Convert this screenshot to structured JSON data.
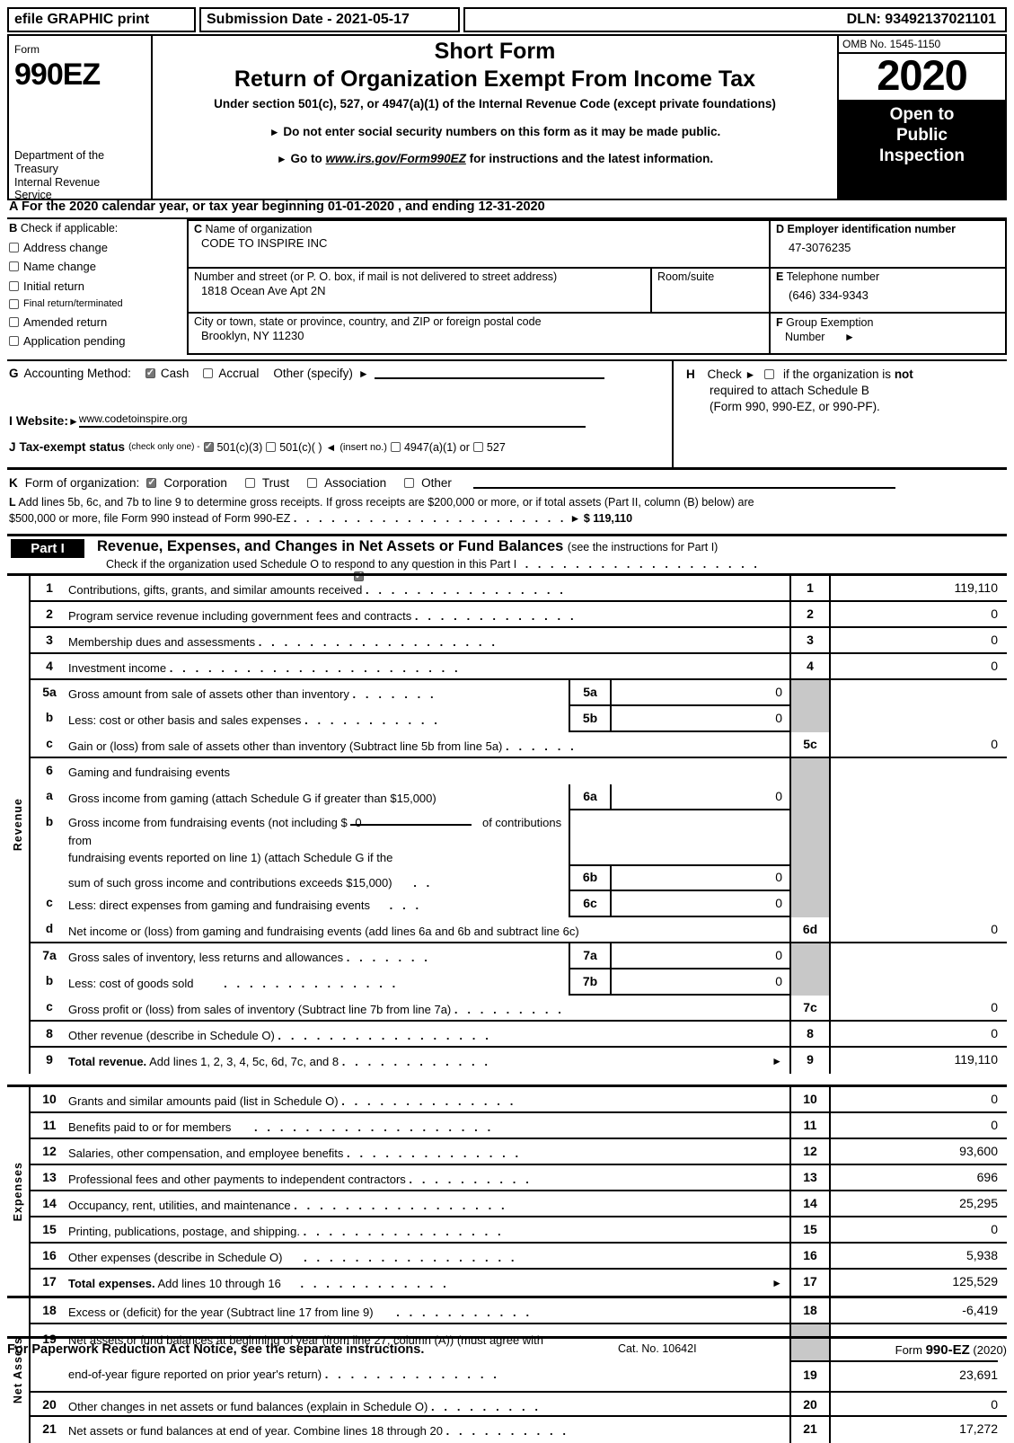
{
  "efile_bar": {
    "print_label": "efile GRAPHIC print",
    "submission_date": "Submission Date - 2021-05-17",
    "dln": "DLN: 93492137021101"
  },
  "header": {
    "form_label": "Form",
    "form_number": "990EZ",
    "department": "Department of the Treasury Internal Revenue Service",
    "title_line1": "Short Form",
    "title_line2": "Return of Organization Exempt From Income Tax",
    "subtitle": "Under section 501(c), 527, or 4947(a)(1) of the Internal Revenue Code (except private foundations)",
    "bullet1": "Do not enter social security numbers on this form as it may be made public.",
    "bullet2_prefix": "Go to",
    "bullet2_link": "www.irs.gov/Form990EZ",
    "bullet2_suffix": "for instructions and the latest information.",
    "omb": "OMB No. 1545-1150",
    "tax_year": "2020",
    "open_to_public": "Open to Public Inspection"
  },
  "line_a": {
    "letter": "A",
    "text": "For the 2020 calendar year, or tax year beginning 01-01-2020 , and ending 12-31-2020"
  },
  "section_b": {
    "letter": "B",
    "heading": "Check if applicable:",
    "items": [
      {
        "label": "Address change",
        "checked": false
      },
      {
        "label": "Name change",
        "checked": false
      },
      {
        "label": "Initial return",
        "checked": false
      },
      {
        "label": "Final return/terminated",
        "checked": false
      },
      {
        "label": "Amended return",
        "checked": false
      },
      {
        "label": "Application pending",
        "checked": false
      }
    ]
  },
  "section_c": {
    "letter": "C",
    "name_label": "Name of organization",
    "name_value": "CODE TO INSPIRE INC",
    "street_label": "Number and street (or P. O. box, if mail is not delivered to street address)",
    "street_value": "1818 Ocean Ave Apt 2N",
    "room_label": "Room/suite",
    "room_value": "",
    "city_label": "City or town, state or province, country, and ZIP or foreign postal code",
    "city_value": "Brooklyn, NY   11230"
  },
  "section_d": {
    "letter": "D",
    "ein_label": "Employer identification number",
    "ein_value": "47-3076235",
    "tel_letter": "E",
    "tel_label": "Telephone number",
    "tel_value": "(646) 334-9343",
    "group_letter": "F",
    "group_label_1": "Group Exemption",
    "group_label_2": "Number"
  },
  "section_g": {
    "letter": "G",
    "label": "Accounting Method:",
    "cash": "Cash",
    "cash_checked": true,
    "accrual": "Accrual",
    "accrual_checked": false,
    "other": "Other (specify)"
  },
  "section_h": {
    "letter": "H",
    "line1_pre": "Check",
    "line1_post": "if the organization is",
    "line1_bold": "not",
    "line2": "required to attach Schedule B",
    "line3": "(Form 990, 990-EZ, or 990-PF).",
    "checked": false
  },
  "section_i": {
    "letter": "I",
    "label": "Website:",
    "value": "www.codetoinspire.org"
  },
  "section_j": {
    "letter": "J",
    "label": "Tax-exempt status",
    "note": "(check only one) -",
    "opt1": "501(c)(3)",
    "opt1_checked": true,
    "opt2": "501(c)(   )",
    "opt2_checked": false,
    "insert": "(insert no.)",
    "opt3": "4947(a)(1) or",
    "opt3_checked": false,
    "opt4": "527",
    "opt4_checked": false
  },
  "section_k": {
    "letter": "K",
    "label": "Form of organization:",
    "options": [
      {
        "label": "Corporation",
        "checked": true
      },
      {
        "label": "Trust",
        "checked": false
      },
      {
        "label": "Association",
        "checked": false
      },
      {
        "label": "Other",
        "checked": false
      }
    ]
  },
  "section_l": {
    "letter": "L",
    "line1": "Add lines 5b, 6c, and 7b to line 9 to determine gross receipts. If gross receipts are $200,000 or more, or if total assets (Part II, column (B) below) are",
    "line2": "$500,000 or more, file Form 990 instead of Form 990-EZ",
    "dots": ". . . . . . . . . . . . . . . . . . . . . .",
    "amount": "$ 119,110"
  },
  "part1": {
    "badge": "Part I",
    "title": "Revenue, Expenses, and Changes in Net Assets or Fund Balances",
    "title_note": "(see the instructions for Part I)",
    "check_text": "Check if the organization used Schedule O to respond to any question in this Part I",
    "check_dots": ". . . . . . . . . . . . . . . . . . .",
    "checked": true
  },
  "revenue": {
    "vlabel": "Revenue",
    "rows": [
      {
        "num": "1",
        "desc": "Contributions, gifts, grants, and similar amounts received",
        "dots": ". . . . . . . . . . . . . . . .",
        "key": "1",
        "value": "119,110"
      },
      {
        "num": "2",
        "desc": "Program service revenue including government fees and contracts",
        "dots": ". . . . . . . . . . . . .",
        "key": "2",
        "value": "0"
      },
      {
        "num": "3",
        "desc": "Membership dues and assessments",
        "dots": ". . . . . . . . . . . . . . . . . . .",
        "key": "3",
        "value": "0"
      },
      {
        "num": "4",
        "desc": "Investment income",
        "dots": ". . . . . . . . . . . . . . . . . . . . . . .",
        "key": "4",
        "value": "0"
      },
      {
        "num": "5a",
        "desc": "Gross amount from sale of assets other than inventory",
        "dots": ". . . . . . .",
        "inner_label": "5a",
        "inner_value": "0",
        "key": "",
        "key_shade": true,
        "value": ""
      },
      {
        "num": "b",
        "desc": "Less: cost or other basis and sales expenses",
        "dots": ". . . . . . . . . . .",
        "inner_label": "5b",
        "inner_value": "0",
        "key": "",
        "key_shade": true,
        "value": ""
      },
      {
        "num": "c",
        "desc": "Gain or (loss) from sale of assets other than inventory (Subtract line 5b from line 5a)",
        "dots": ". . . . . .",
        "key": "5c",
        "value": "0"
      },
      {
        "num": "6",
        "desc": "Gaming and fundraising events",
        "dots": "",
        "key": "",
        "key_shade": true,
        "value": ""
      },
      {
        "num": "a",
        "desc": "Gross income from gaming (attach Schedule G if greater than $15,000)",
        "dots": "",
        "inner_label": "6a",
        "inner_value": "0",
        "key": "",
        "key_shade": true,
        "value": ""
      },
      {
        "num": "b",
        "desc_l1": "Gross income from fundraising events (not including $",
        "inline_value": "0",
        "desc_l1b": "of contributions from",
        "desc_l2": "fundraising events reported on line 1) (attach Schedule G if the",
        "desc_l3": "sum of such gross income and contributions exceeds $15,000)",
        "dots": ". .",
        "inner_label": "6b",
        "inner_value": "0",
        "key": "",
        "key_shade": true,
        "value": ""
      },
      {
        "num": "c",
        "desc": "Less: direct expenses from gaming and fundraising events",
        "dots": ". . .",
        "inner_label": "6c",
        "inner_value": "0",
        "key": "",
        "key_shade": true,
        "value": ""
      },
      {
        "num": "d",
        "desc": "Net income or (loss) from gaming and fundraising events (add lines 6a and 6b and subtract line 6c)",
        "dots": "",
        "key": "6d",
        "value": "0"
      },
      {
        "num": "7a",
        "desc": "Gross sales of inventory, less returns and allowances",
        "dots": ". . . . . . .",
        "inner_label": "7a",
        "inner_value": "0",
        "key": "",
        "key_shade": true,
        "value": ""
      },
      {
        "num": "b",
        "desc": "Less: cost of goods sold",
        "dots": ". . . . . . . . . . . . . .",
        "inner_label": "7b",
        "inner_value": "0",
        "key": "",
        "key_shade": true,
        "value": ""
      },
      {
        "num": "c",
        "desc": "Gross profit or (loss) from sales of inventory (Subtract line 7b from line 7a)",
        "dots": ". . . . . . . . .",
        "key": "7c",
        "value": "0"
      },
      {
        "num": "8",
        "desc": "Other revenue (describe in Schedule O)",
        "dots": ". . . . . . . . . . . . . . . . .",
        "key": "8",
        "value": "0"
      },
      {
        "num": "9",
        "desc_bold": "Total revenue.",
        "desc": "Add lines 1, 2, 3, 4, 5c, 6d, 7c, and 8",
        "dots": ". . . . . . . . . . . .",
        "arrow": true,
        "key": "9",
        "value": "119,110"
      }
    ]
  },
  "expenses": {
    "vlabel": "Expenses",
    "rows": [
      {
        "num": "10",
        "desc": "Grants and similar amounts paid (list in Schedule O)",
        "dots": ". . . . . . . . . . . . . .",
        "key": "10",
        "value": "0"
      },
      {
        "num": "11",
        "desc": "Benefits paid to or for members",
        "dots": ". . . . . . . . . . . . . . . . . . .",
        "key": "11",
        "value": "0"
      },
      {
        "num": "12",
        "desc": "Salaries, other compensation, and employee benefits",
        "dots": ". . . . . . . . . . . . . .",
        "key": "12",
        "value": "93,600"
      },
      {
        "num": "13",
        "desc": "Professional fees and other payments to independent contractors",
        "dots": ". . . . . . . . . .",
        "key": "13",
        "value": "696"
      },
      {
        "num": "14",
        "desc": "Occupancy, rent, utilities, and maintenance",
        "dots": ". . . . . . . . . . . . . . . . .",
        "key": "14",
        "value": "25,295"
      },
      {
        "num": "15",
        "desc": "Printing, publications, postage, and shipping.",
        "dots": ". . . . . . . . . . . . . . . .",
        "key": "15",
        "value": "0"
      },
      {
        "num": "16",
        "desc": "Other expenses (describe in Schedule O)",
        "dots": ". . . . . . . . . . . . . . . . .",
        "key": "16",
        "value": "5,938"
      },
      {
        "num": "17",
        "desc_bold": "Total expenses.",
        "desc": "Add lines 10 through 16",
        "dots": ". . . . . . . . . . . .",
        "arrow": true,
        "key": "17",
        "value": "125,529"
      }
    ]
  },
  "net_assets": {
    "vlabel": "Net Assets",
    "rows": [
      {
        "num": "18",
        "desc": "Excess or (deficit) for the year (Subtract line 17 from line 9)",
        "dots": ". . . . . . . . . . .",
        "key": "18",
        "value": "-6,419"
      },
      {
        "num": "19",
        "desc_l1": "Net assets or fund balances at beginning of year (from line 27, column (A)) (must agree with",
        "desc_l2": "end-of-year figure reported on prior year's return)",
        "dots": ". . . . . . . . . . . . . .",
        "key": "19",
        "value": "23,691",
        "two_line": true
      },
      {
        "num": "20",
        "desc": "Other changes in net assets or fund balances (explain in Schedule O)",
        "dots": ". . . . . . . . .",
        "key": "20",
        "value": "0"
      },
      {
        "num": "21",
        "desc": "Net assets or fund balances at end of year. Combine lines 18 through 20",
        "dots": ". . . . . . . . . .",
        "key": "21",
        "value": "17,272"
      }
    ]
  },
  "footer": {
    "notice": "For Paperwork Reduction Act Notice, see the separate instructions.",
    "cat": "Cat. No. 10642I",
    "form_prefix": "Form",
    "form_name": "990-EZ",
    "form_year": "(2020)"
  }
}
